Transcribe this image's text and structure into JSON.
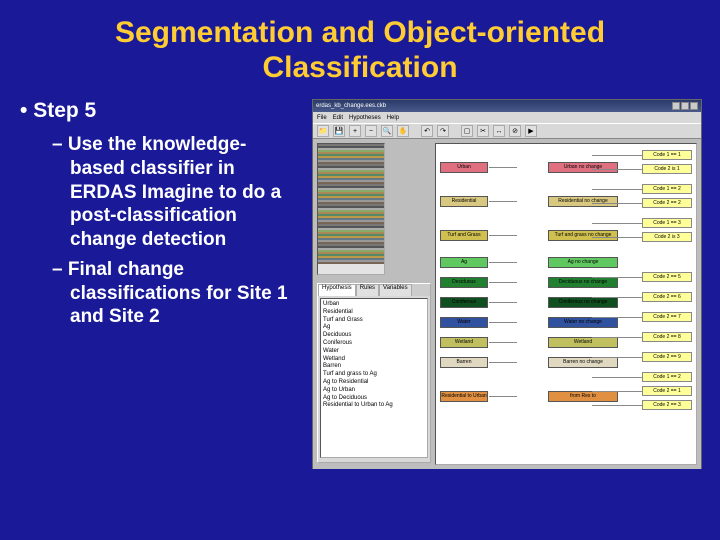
{
  "title": "Segmentation and Object-oriented Classification",
  "step_label": "Step 5",
  "bullets": [
    "Use the knowledge-based classifier in ERDAS Imagine to do a post-classification change detection",
    "Final change classifications for Site 1 and Site 2"
  ],
  "screenshot": {
    "window_title": "erdas_kb_change.ees.ckb",
    "menu": [
      "File",
      "Edit",
      "Hypotheses",
      "Help"
    ],
    "toolbar": [
      "folder-icon",
      "save-icon",
      "zoom-in-icon",
      "zoom-out-icon",
      "zoom-icon",
      "hand-icon",
      "|",
      "undo-icon",
      "redo-icon",
      "|",
      "add-icon",
      "cut-icon",
      "link-icon",
      "unlink-icon",
      "run-icon"
    ],
    "panel_tabs": [
      "Hypothesis",
      "Rules",
      "Variables"
    ],
    "list_items": [
      "Urban",
      "Residential",
      "Turf and Grass",
      "Ag",
      "Deciduous",
      "Coniferous",
      "Water",
      "Wetland",
      "Barren",
      "Turf and grass to Ag",
      "Ag to Residential",
      "Ag to Urban",
      "Ag to Deciduous",
      "Residential to Urban to Ag"
    ],
    "rows": [
      {
        "left": "Urban",
        "left_color": "#e07080",
        "mid": "Urban no change",
        "rules": [
          "Code 1 == 1",
          "Code 2 is 1"
        ]
      },
      {
        "left": "Residential",
        "left_color": "#d8c880",
        "mid": "Residential no change",
        "rules": [
          "Code 1 == 2",
          "Code 2 == 2"
        ]
      },
      {
        "left": "Turf and Grass",
        "left_color": "#d0c050",
        "mid": "Turf and grass no change",
        "rules": [
          "Code 1 == 3",
          "Code 2 is 3"
        ]
      },
      {
        "left": "Ag",
        "left_color": "#60c860",
        "mid": "Ag no change",
        "rules": []
      },
      {
        "left": "Deciduous",
        "left_color": "#208030",
        "mid": "Deciduous no change",
        "rules": [
          "Code 2 == 5"
        ]
      },
      {
        "left": "Coniferous",
        "left_color": "#105020",
        "mid": "Coniferous no change",
        "rules": [
          "Code 2 == 6"
        ]
      },
      {
        "left": "Water",
        "left_color": "#3050a0",
        "mid": "Water no change",
        "rules": [
          "Code 2 == 7"
        ]
      },
      {
        "left": "Wetland",
        "left_color": "#c0c060",
        "mid": "Wetland",
        "rules": [
          "Code 2 == 8"
        ]
      },
      {
        "left": "Barren",
        "left_color": "#e0d8c0",
        "mid": "Barren no change",
        "rules": [
          "Code 2 == 9"
        ]
      },
      {
        "left": "Residential to Urban",
        "left_color": "#e09040",
        "mid": "from Res to",
        "rules": [
          "Code 1 == 2",
          "Code 2 == 1",
          "Code 2 == 3"
        ]
      }
    ]
  }
}
